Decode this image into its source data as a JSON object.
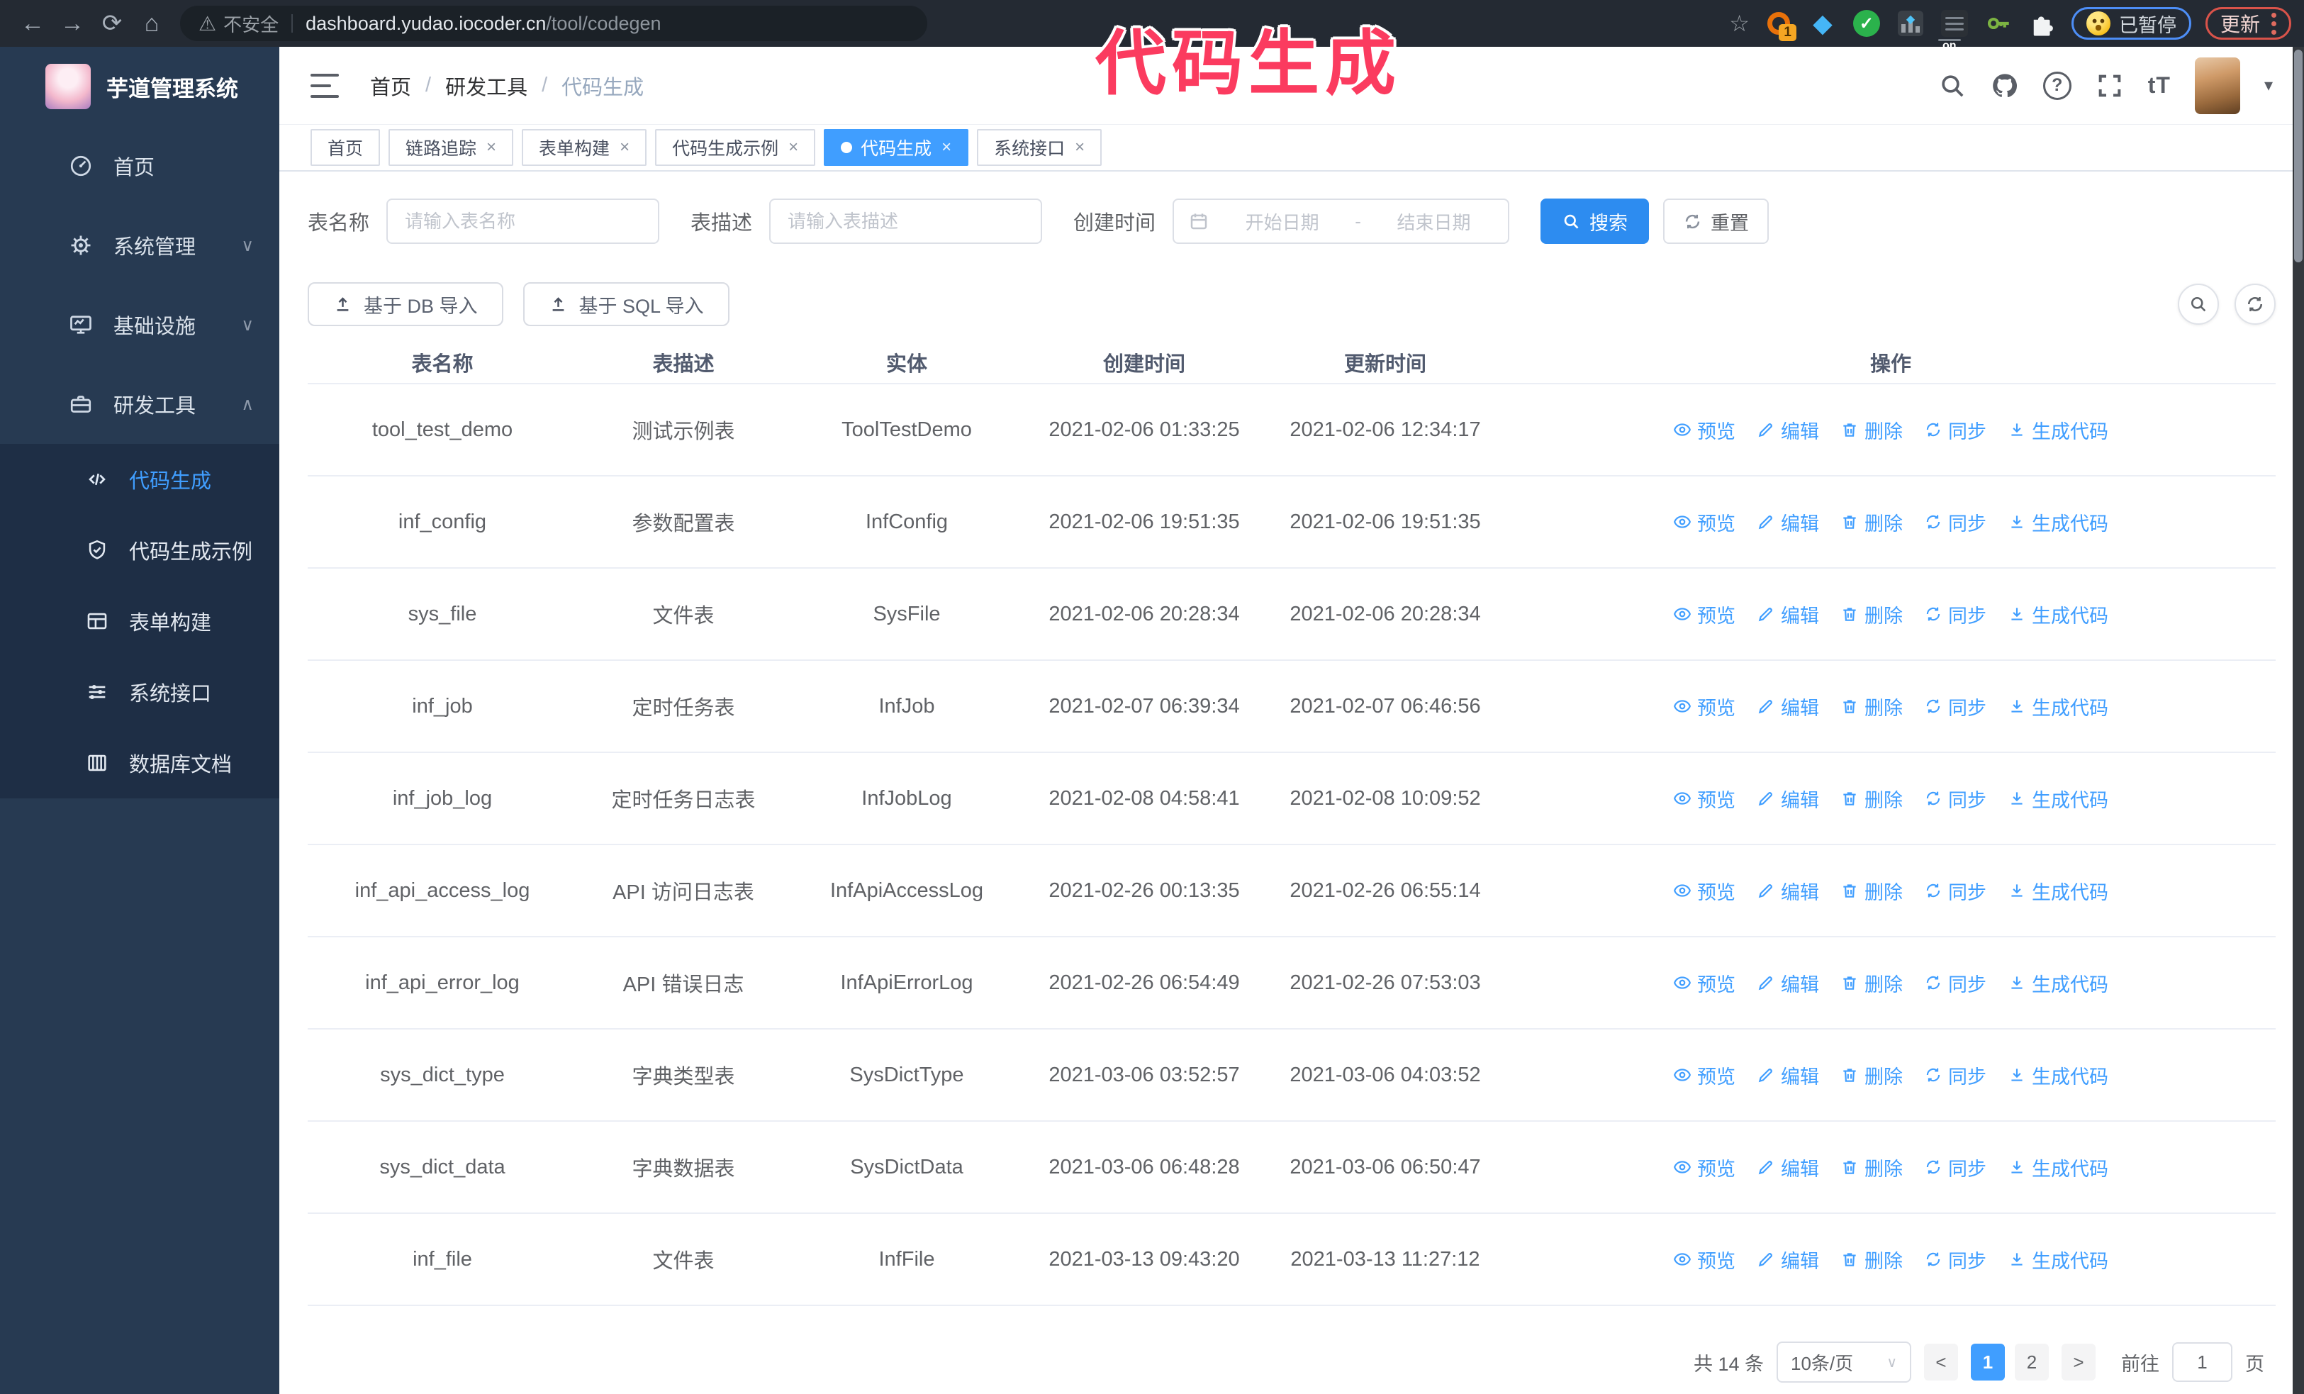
{
  "glyphs": {
    "back": "←",
    "forward": "→",
    "reload": "⟳",
    "home": "⌂",
    "warning": "⚠",
    "star": "☆",
    "gem": "◆",
    "check": "✓",
    "close": "×",
    "chevron_down": "∨",
    "chevron_up": "∧",
    "breadcrumb_separator": "/",
    "caret_down": "▾",
    "question": "?",
    "text_size": "tT",
    "select_caret": "∨",
    "prev": "<",
    "next": ">"
  },
  "colors": {
    "accent": "#409eff",
    "search_button": "#2d8cf0",
    "annotation": "#fb3b5f",
    "sidebar_bg": "#273a52",
    "submenu_bg": "#1e2e45",
    "chrome_bg": "#242a33"
  },
  "browser": {
    "security_warning": "不安全",
    "url_host": "dashboard.yudao.iocoder.cn",
    "url_path": "/tool/codegen",
    "extension_badge": "1",
    "extension_on_badge": "on",
    "paused_badge": "已暂停",
    "update_button": "更新"
  },
  "overlay": {
    "annotation": "代码生成"
  },
  "sidebar": {
    "app_title": "芋道管理系统",
    "items": [
      {
        "label": "首页",
        "icon": "dashboard-icon"
      },
      {
        "label": "系统管理",
        "icon": "gear-icon",
        "chevron": "down"
      },
      {
        "label": "基础设施",
        "icon": "monitor-icon",
        "chevron": "down"
      },
      {
        "label": "研发工具",
        "icon": "toolbox-icon",
        "chevron": "up",
        "expanded": true
      }
    ],
    "submenu": [
      {
        "label": "代码生成",
        "icon": "code-icon",
        "active": true
      },
      {
        "label": "代码生成示例",
        "icon": "shield-check-icon"
      },
      {
        "label": "表单构建",
        "icon": "form-icon"
      },
      {
        "label": "系统接口",
        "icon": "sliders-icon"
      },
      {
        "label": "数据库文档",
        "icon": "database-doc-icon"
      }
    ]
  },
  "header": {
    "breadcrumb": [
      "首页",
      "研发工具",
      "代码生成"
    ]
  },
  "tags": [
    {
      "label": "首页",
      "closable": false,
      "active": false
    },
    {
      "label": "链路追踪",
      "closable": true,
      "active": false
    },
    {
      "label": "表单构建",
      "closable": true,
      "active": false
    },
    {
      "label": "代码生成示例",
      "closable": true,
      "active": false
    },
    {
      "label": "代码生成",
      "closable": true,
      "active": true
    },
    {
      "label": "系统接口",
      "closable": true,
      "active": false
    }
  ],
  "search_form": {
    "table_name_label": "表名称",
    "table_name_placeholder": "请输入表名称",
    "table_desc_label": "表描述",
    "table_desc_placeholder": "请输入表描述",
    "create_time_label": "创建时间",
    "date_start_placeholder": "开始日期",
    "date_separator": "-",
    "date_end_placeholder": "结束日期",
    "search_button": "搜索",
    "reset_button": "重置"
  },
  "toolbar": {
    "import_db_button": "基于 DB 导入",
    "import_sql_button": "基于 SQL 导入"
  },
  "table": {
    "columns": [
      "表名称",
      "表描述",
      "实体",
      "创建时间",
      "更新时间",
      "操作"
    ],
    "row_actions": [
      "预览",
      "编辑",
      "删除",
      "同步",
      "生成代码"
    ],
    "rows": [
      {
        "name": "tool_test_demo",
        "description": "测试示例表",
        "entity": "ToolTestDemo",
        "created_at": "2021-02-06 01:33:25",
        "updated_at": "2021-02-06 12:34:17"
      },
      {
        "name": "inf_config",
        "description": "参数配置表",
        "entity": "InfConfig",
        "created_at": "2021-02-06 19:51:35",
        "updated_at": "2021-02-06 19:51:35"
      },
      {
        "name": "sys_file",
        "description": "文件表",
        "entity": "SysFile",
        "created_at": "2021-02-06 20:28:34",
        "updated_at": "2021-02-06 20:28:34"
      },
      {
        "name": "inf_job",
        "description": "定时任务表",
        "entity": "InfJob",
        "created_at": "2021-02-07 06:39:34",
        "updated_at": "2021-02-07 06:46:56"
      },
      {
        "name": "inf_job_log",
        "description": "定时任务日志表",
        "entity": "InfJobLog",
        "created_at": "2021-02-08 04:58:41",
        "updated_at": "2021-02-08 10:09:52"
      },
      {
        "name": "inf_api_access_log",
        "description": "API 访问日志表",
        "entity": "InfApiAccessLog",
        "created_at": "2021-02-26 00:13:35",
        "updated_at": "2021-02-26 06:55:14"
      },
      {
        "name": "inf_api_error_log",
        "description": "API 错误日志",
        "entity": "InfApiErrorLog",
        "created_at": "2021-02-26 06:54:49",
        "updated_at": "2021-02-26 07:53:03"
      },
      {
        "name": "sys_dict_type",
        "description": "字典类型表",
        "entity": "SysDictType",
        "created_at": "2021-03-06 03:52:57",
        "updated_at": "2021-03-06 04:03:52"
      },
      {
        "name": "sys_dict_data",
        "description": "字典数据表",
        "entity": "SysDictData",
        "created_at": "2021-03-06 06:48:28",
        "updated_at": "2021-03-06 06:50:47"
      },
      {
        "name": "inf_file",
        "description": "文件表",
        "entity": "InfFile",
        "created_at": "2021-03-13 09:43:20",
        "updated_at": "2021-03-13 11:27:12"
      }
    ]
  },
  "pagination": {
    "total": "共 14 条",
    "page_size": "10条/页",
    "pages": [
      "1",
      "2"
    ],
    "active_page": "1",
    "goto_label": "前往",
    "goto_value": "1",
    "goto_suffix": "页"
  }
}
